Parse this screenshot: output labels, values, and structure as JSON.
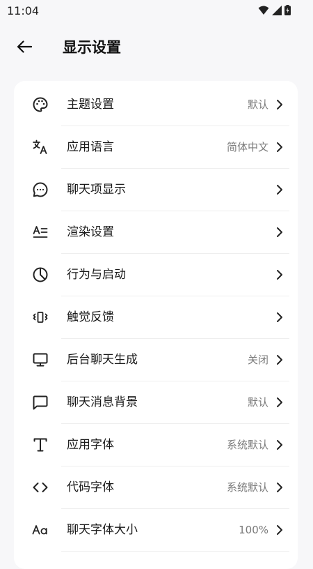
{
  "status": {
    "time": "11:04"
  },
  "header": {
    "title": "显示设置"
  },
  "items": [
    {
      "icon": "palette-icon",
      "label": "主题设置",
      "value": "默认"
    },
    {
      "icon": "translate-icon",
      "label": "应用语言",
      "value": "简体中文"
    },
    {
      "icon": "chat-bubble-dots-icon",
      "label": "聊天项显示",
      "value": ""
    },
    {
      "icon": "text-format-icon",
      "label": "渲染设置",
      "value": ""
    },
    {
      "icon": "pie-chart-icon",
      "label": "行为与启动",
      "value": ""
    },
    {
      "icon": "vibration-icon",
      "label": "触觉反馈",
      "value": ""
    },
    {
      "icon": "monitor-icon",
      "label": "后台聊天生成",
      "value": "关闭"
    },
    {
      "icon": "chat-bubble-icon",
      "label": "聊天消息背景",
      "value": "默认"
    },
    {
      "icon": "font-t-icon",
      "label": "应用字体",
      "value": "系统默认"
    },
    {
      "icon": "code-icon",
      "label": "代码字体",
      "value": "系统默认"
    },
    {
      "icon": "font-size-icon",
      "label": "聊天字体大小",
      "value": "100%"
    }
  ]
}
